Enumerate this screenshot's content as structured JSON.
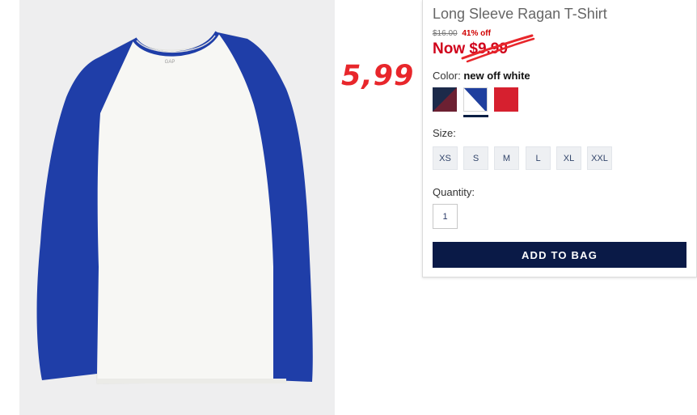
{
  "product": {
    "title": "Long Sleeve Ragan T-Shirt",
    "old_price": "$16.00",
    "discount": "41% off",
    "now_price": "Now $9.99",
    "handwritten_price": "5,99",
    "image_logo_text": "GAP"
  },
  "color": {
    "label": "Color:",
    "selected": "new off white",
    "swatches": [
      {
        "name": "navy-burgundy",
        "colors": [
          "#1c2a4a",
          "#7a1f2e"
        ]
      },
      {
        "name": "blue-off-white",
        "colors": [
          "#ffffff",
          "#1f3f9e"
        ]
      },
      {
        "name": "red",
        "colors": [
          "#d6202f"
        ]
      }
    ]
  },
  "size": {
    "label": "Size:",
    "options": [
      "XS",
      "S",
      "M",
      "L",
      "XL",
      "XXL"
    ]
  },
  "quantity": {
    "label": "Quantity:",
    "value": "1"
  },
  "cta": {
    "add_to_bag": "ADD TO BAG"
  },
  "colors": {
    "sleeve_blue": "#1f3ea8",
    "body_white": "#f7f7f4",
    "accent_red": "#d0021b",
    "button_navy": "#0a1a47"
  }
}
